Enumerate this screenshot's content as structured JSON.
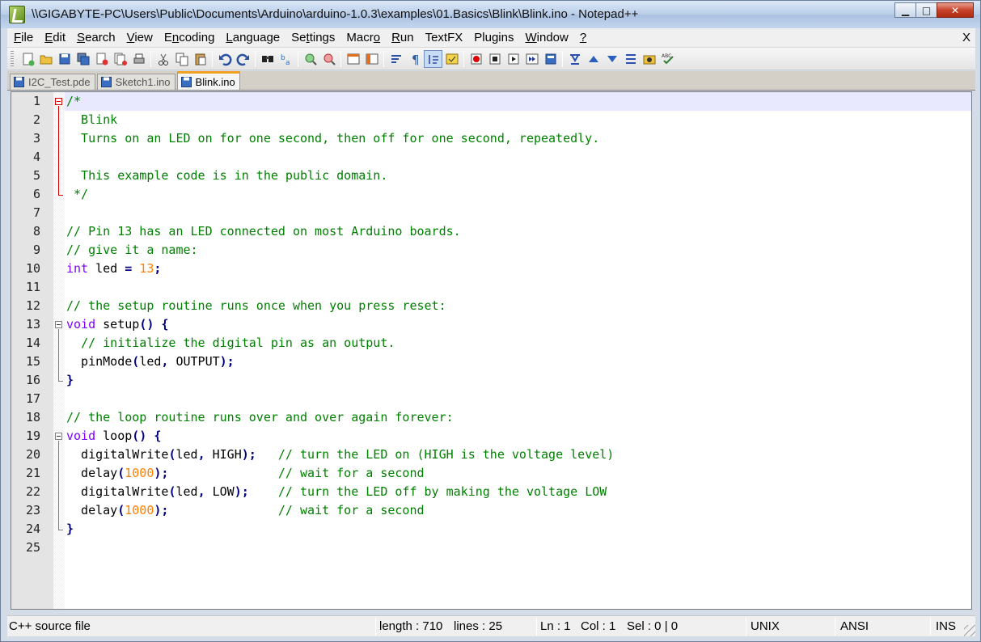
{
  "window": {
    "title": "\\\\GIGABYTE-PC\\Users\\Public\\Documents\\Arduino\\arduino-1.0.3\\examples\\01.Basics\\Blink\\Blink.ino - Notepad++",
    "minimize_glyph": "▁",
    "maximize_glyph": "□",
    "close_glyph": "✕"
  },
  "menu": {
    "items": [
      {
        "label": "File",
        "accel": "F"
      },
      {
        "label": "Edit",
        "accel": "E"
      },
      {
        "label": "Search",
        "accel": "S"
      },
      {
        "label": "View",
        "accel": "V"
      },
      {
        "label": "Encoding",
        "accel": "n"
      },
      {
        "label": "Language",
        "accel": "L"
      },
      {
        "label": "Settings",
        "accel": "t"
      },
      {
        "label": "Macro",
        "accel": "o"
      },
      {
        "label": "Run",
        "accel": "R"
      },
      {
        "label": "TextFX",
        "accel": ""
      },
      {
        "label": "Plugins",
        "accel": ""
      },
      {
        "label": "Window",
        "accel": "W"
      },
      {
        "label": "?",
        "accel": "?"
      }
    ],
    "close_label": "X"
  },
  "toolbar": {
    "buttons": [
      "new-file-icon",
      "open-file-icon",
      "save-icon",
      "save-all-icon",
      "close-icon",
      "close-all-icon",
      "print-icon",
      "|",
      "cut-icon",
      "copy-icon",
      "paste-icon",
      "|",
      "undo-icon",
      "redo-icon",
      "|",
      "find-icon",
      "replace-icon",
      "|",
      "zoom-in-icon",
      "zoom-out-icon",
      "|",
      "sync-vertical-icon",
      "sync-horizontal-icon",
      "|",
      "word-wrap-icon",
      "show-all-chars-icon",
      "indent-guide-icon",
      "user-lang-icon",
      "|",
      "record-macro-icon",
      "stop-record-icon",
      "play-macro-icon",
      "play-multiple-icon",
      "save-macro-icon",
      "|",
      "textfx-sort-icon",
      "textfx-up-icon",
      "textfx-down-icon",
      "textfx-bookmark-icon",
      "textfx-plugin-icon",
      "spell-check-icon"
    ],
    "active_button": "indent-guide-icon"
  },
  "tabs": [
    {
      "label": "I2C_Test.pde",
      "active": false
    },
    {
      "label": "Sketch1.ino",
      "active": false
    },
    {
      "label": "Blink.ino",
      "active": true
    }
  ],
  "editor": {
    "current_line": 1,
    "lines": [
      [
        [
          "c-comment",
          "/*"
        ]
      ],
      [
        [
          "c-comment",
          "  Blink"
        ]
      ],
      [
        [
          "c-comment",
          "  Turns on an LED on for one second, then off for one second, repeatedly."
        ]
      ],
      [
        [
          "c-comment",
          ""
        ]
      ],
      [
        [
          "c-comment",
          "  This example code is in the public domain."
        ]
      ],
      [
        [
          "c-comment",
          " */"
        ]
      ],
      [],
      [
        [
          "c-comment",
          "// Pin 13 has an LED connected on most Arduino boards."
        ]
      ],
      [
        [
          "c-comment",
          "// give it a name:"
        ]
      ],
      [
        [
          "c-keyword",
          "int"
        ],
        [
          "c-plain",
          " led "
        ],
        [
          "c-op",
          "="
        ],
        [
          "c-plain",
          " "
        ],
        [
          "c-number",
          "13"
        ],
        [
          "c-op",
          ";"
        ]
      ],
      [],
      [
        [
          "c-comment",
          "// the setup routine runs once when you press reset:"
        ]
      ],
      [
        [
          "c-keyword",
          "void"
        ],
        [
          "c-plain",
          " setup"
        ],
        [
          "c-op",
          "()"
        ],
        [
          "c-plain",
          " "
        ],
        [
          "c-op",
          "{"
        ]
      ],
      [
        [
          "c-plain",
          "  "
        ],
        [
          "c-comment",
          "// initialize the digital pin as an output."
        ]
      ],
      [
        [
          "c-plain",
          "  pinMode"
        ],
        [
          "c-op",
          "("
        ],
        [
          "c-plain",
          "led"
        ],
        [
          "c-op",
          ","
        ],
        [
          "c-plain",
          " OUTPUT"
        ],
        [
          "c-op",
          ");"
        ]
      ],
      [
        [
          "c-op",
          "}"
        ]
      ],
      [],
      [
        [
          "c-comment",
          "// the loop routine runs over and over again forever:"
        ]
      ],
      [
        [
          "c-keyword",
          "void"
        ],
        [
          "c-plain",
          " loop"
        ],
        [
          "c-op",
          "()"
        ],
        [
          "c-plain",
          " "
        ],
        [
          "c-op",
          "{"
        ]
      ],
      [
        [
          "c-plain",
          "  digitalWrite"
        ],
        [
          "c-op",
          "("
        ],
        [
          "c-plain",
          "led"
        ],
        [
          "c-op",
          ","
        ],
        [
          "c-plain",
          " HIGH"
        ],
        [
          "c-op",
          ");"
        ],
        [
          "c-plain",
          "   "
        ],
        [
          "c-comment",
          "// turn the LED on (HIGH is the voltage level)"
        ]
      ],
      [
        [
          "c-plain",
          "  delay"
        ],
        [
          "c-op",
          "("
        ],
        [
          "c-number",
          "1000"
        ],
        [
          "c-op",
          ");"
        ],
        [
          "c-plain",
          "               "
        ],
        [
          "c-comment",
          "// wait for a second"
        ]
      ],
      [
        [
          "c-plain",
          "  digitalWrite"
        ],
        [
          "c-op",
          "("
        ],
        [
          "c-plain",
          "led"
        ],
        [
          "c-op",
          ","
        ],
        [
          "c-plain",
          " LOW"
        ],
        [
          "c-op",
          ");"
        ],
        [
          "c-plain",
          "    "
        ],
        [
          "c-comment",
          "// turn the LED off by making the voltage LOW"
        ]
      ],
      [
        [
          "c-plain",
          "  delay"
        ],
        [
          "c-op",
          "("
        ],
        [
          "c-number",
          "1000"
        ],
        [
          "c-op",
          ");"
        ],
        [
          "c-plain",
          "               "
        ],
        [
          "c-comment",
          "// wait for a second"
        ]
      ],
      [
        [
          "c-op",
          "}"
        ]
      ],
      []
    ],
    "folds": [
      {
        "start": 1,
        "end": 6,
        "color": "red"
      },
      {
        "start": 13,
        "end": 16,
        "color": "gray"
      },
      {
        "start": 19,
        "end": 24,
        "color": "gray"
      }
    ]
  },
  "statusbar": {
    "file_type": "C++ source file",
    "length": "length : 710",
    "lines": "lines : 25",
    "ln": "Ln : 1",
    "col": "Col : 1",
    "sel": "Sel : 0 | 0",
    "eol": "UNIX",
    "encoding": "ANSI",
    "mode": "INS"
  },
  "colors": {
    "comment": "#008000",
    "keyword": "#8000ff",
    "number": "#ff8000",
    "operator": "#000080",
    "current_line": "#e8e8ff",
    "active_tab_accent": "#f2a024"
  }
}
